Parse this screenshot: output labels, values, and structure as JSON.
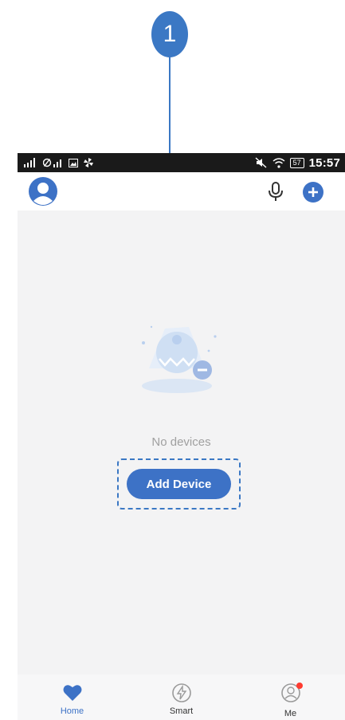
{
  "callout": {
    "number": "1"
  },
  "status_bar": {
    "time": "15:57",
    "battery": "57"
  },
  "empty_state": {
    "message": "No devices",
    "button_label": "Add Device"
  },
  "bottom_nav": {
    "items": [
      {
        "label": "Home",
        "icon": "heart-icon",
        "active": true
      },
      {
        "label": "Smart",
        "icon": "lightning-icon",
        "active": false
      },
      {
        "label": "Me",
        "icon": "user-icon",
        "active": false,
        "badge": true
      }
    ]
  },
  "colors": {
    "accent": "#3d72c6",
    "badge": "#ff3b30",
    "background": "#f3f3f4"
  }
}
